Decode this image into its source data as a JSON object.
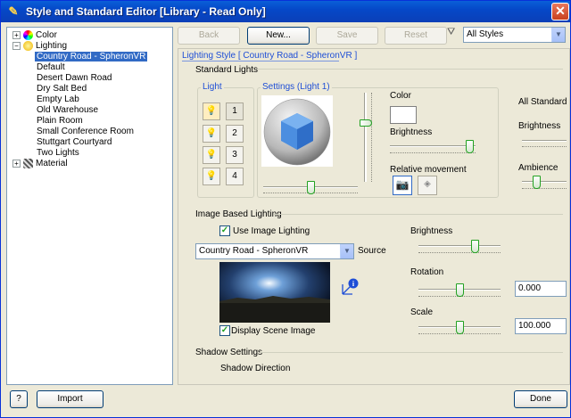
{
  "window": {
    "title": "Style and Standard Editor [Library - Read Only]"
  },
  "tree": {
    "items": [
      {
        "label": "Color",
        "expander": "+",
        "icon": "color-wheel-icon"
      },
      {
        "label": "Lighting",
        "expander": "−",
        "icon": "light-bulb-icon"
      },
      {
        "label": "Country Road - SpheronVR",
        "selected": true
      },
      {
        "label": "Default"
      },
      {
        "label": "Desert Dawn Road"
      },
      {
        "label": "Dry Salt Bed"
      },
      {
        "label": "Empty Lab"
      },
      {
        "label": "Old Warehouse"
      },
      {
        "label": "Plain Room"
      },
      {
        "label": "Small Conference Room"
      },
      {
        "label": "Stuttgart Courtyard"
      },
      {
        "label": "Two Lights"
      },
      {
        "label": "Material",
        "expander": "+",
        "icon": "material-icon"
      }
    ]
  },
  "toolbar": {
    "back": "Back",
    "new": "New...",
    "save": "Save",
    "reset": "Reset",
    "filter_value": "All Styles"
  },
  "panel": {
    "header": "Lighting Style [ Country Road - SpheronVR ]",
    "standard_lights": "Standard Lights",
    "light_group": "Light",
    "light_numbers": [
      "1",
      "2",
      "3",
      "4"
    ],
    "settings_group": "Settings (Light 1)",
    "color": "Color",
    "brightness": "Brightness",
    "relative_movement": "Relative movement",
    "all_standard": "All Standard",
    "all_brightness": "Brightness",
    "ambience": "Ambience",
    "ibl_header": "Image Based Lighting",
    "use_image_lighting": "Use Image Lighting",
    "use_image_lighting_checked": true,
    "source_value": "Country Road - SpheronVR",
    "source_label": "Source",
    "ibl_brightness": "Brightness",
    "rotation": "Rotation",
    "rotation_value": "0.000",
    "scale": "Scale",
    "scale_value": "100.000",
    "display_scene_image": "Display Scene Image",
    "display_scene_image_checked": true,
    "shadow_settings": "Shadow Settings",
    "shadow_direction": "Shadow Direction"
  },
  "bottom": {
    "help": "?",
    "import": "Import",
    "done": "Done"
  },
  "sliders": {
    "light_brightness": 0.9,
    "light_vertical": 0.38,
    "light_horizontal": 0.5,
    "all_brightness": 0.5,
    "ambience": 0.25,
    "ibl_brightness": 0.65,
    "rotation": 0.5,
    "scale": 0.5
  },
  "colors": {
    "accent": "#1e4ed6",
    "title_bar": "#0548c8",
    "selection": "#316ac5",
    "light_color": "#ffffff"
  }
}
